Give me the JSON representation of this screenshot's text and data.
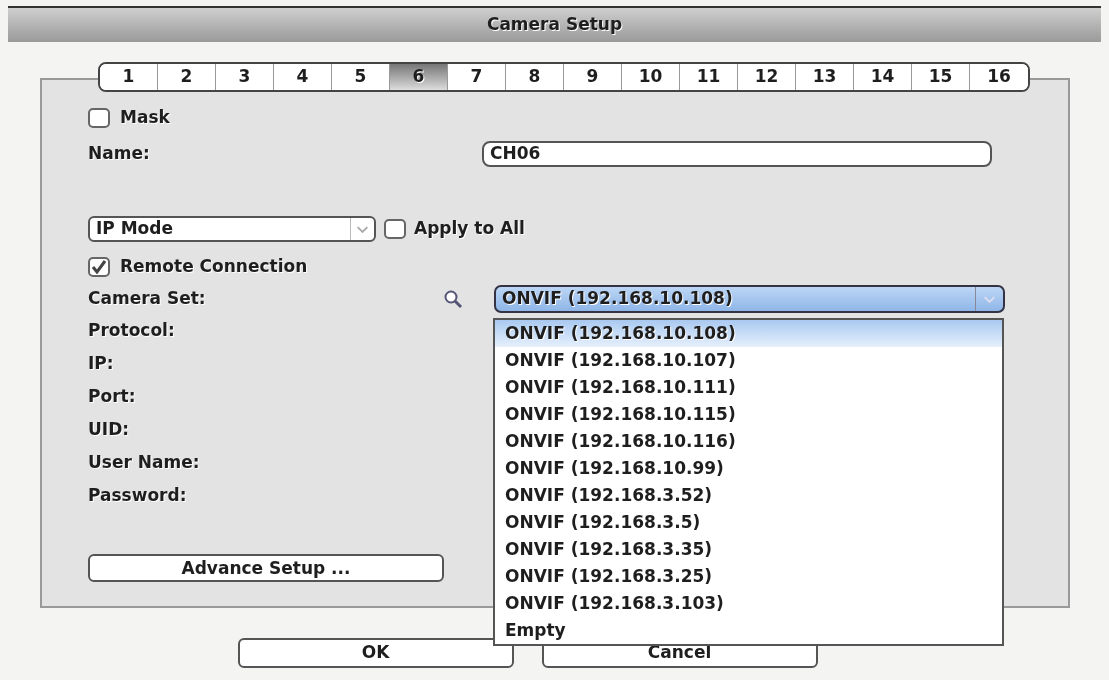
{
  "window": {
    "title": "Camera Setup"
  },
  "tabs": [
    {
      "label": "1",
      "selected": false
    },
    {
      "label": "2",
      "selected": false
    },
    {
      "label": "3",
      "selected": false
    },
    {
      "label": "4",
      "selected": false
    },
    {
      "label": "5",
      "selected": false
    },
    {
      "label": "6",
      "selected": true
    },
    {
      "label": "7",
      "selected": false
    },
    {
      "label": "8",
      "selected": false
    },
    {
      "label": "9",
      "selected": false
    },
    {
      "label": "10",
      "selected": false
    },
    {
      "label": "11",
      "selected": false
    },
    {
      "label": "12",
      "selected": false
    },
    {
      "label": "13",
      "selected": false
    },
    {
      "label": "14",
      "selected": false
    },
    {
      "label": "15",
      "selected": false
    },
    {
      "label": "16",
      "selected": false
    }
  ],
  "mask": {
    "label": "Mask",
    "checked": false
  },
  "name": {
    "label": "Name:",
    "value": "CH06"
  },
  "mode_select": {
    "value": "IP Mode"
  },
  "apply_to_all": {
    "label": "Apply to All",
    "checked": false
  },
  "remote_connection": {
    "label": "Remote Connection",
    "checked": true
  },
  "camera_set": {
    "label": "Camera Set:",
    "value": "ONVIF (192.168.10.108)",
    "expanded": true,
    "options": [
      {
        "label": "ONVIF (192.168.10.108)",
        "selected": true
      },
      {
        "label": "ONVIF (192.168.10.107)",
        "selected": false
      },
      {
        "label": "ONVIF (192.168.10.111)",
        "selected": false
      },
      {
        "label": "ONVIF (192.168.10.115)",
        "selected": false
      },
      {
        "label": "ONVIF (192.168.10.116)",
        "selected": false
      },
      {
        "label": "ONVIF (192.168.10.99)",
        "selected": false
      },
      {
        "label": "ONVIF (192.168.3.52)",
        "selected": false
      },
      {
        "label": "ONVIF (192.168.3.5)",
        "selected": false
      },
      {
        "label": "ONVIF (192.168.3.35)",
        "selected": false
      },
      {
        "label": "ONVIF (192.168.3.25)",
        "selected": false
      },
      {
        "label": "ONVIF (192.168.3.103)",
        "selected": false
      },
      {
        "label": "Empty",
        "selected": false
      }
    ]
  },
  "fields": [
    "Protocol:",
    "IP:",
    "Port:",
    "UID:",
    "User Name:",
    "Password:"
  ],
  "advance_button": "Advance Setup ...",
  "buttons": [
    "OK",
    "Cancel"
  ]
}
